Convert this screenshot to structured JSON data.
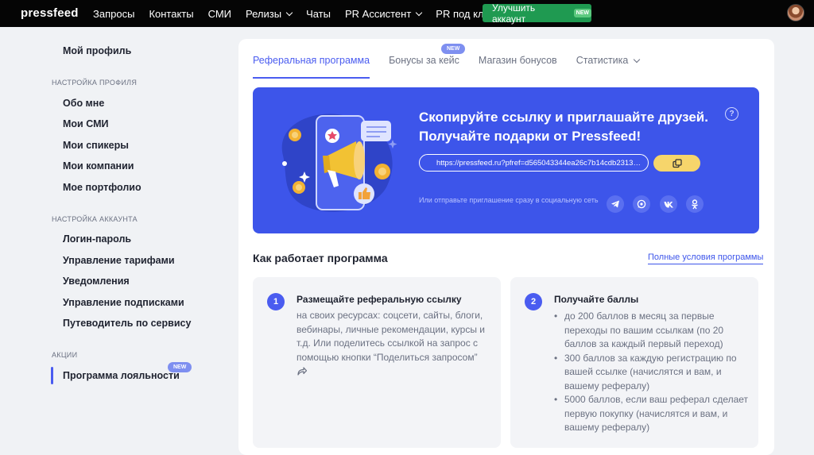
{
  "topbar": {
    "logo": "pressfeed",
    "nav": [
      {
        "label": "Запросы",
        "has_dropdown": false
      },
      {
        "label": "Контакты",
        "has_dropdown": false
      },
      {
        "label": "СМИ",
        "has_dropdown": false
      },
      {
        "label": "Релизы",
        "has_dropdown": true
      },
      {
        "label": "Чаты",
        "has_dropdown": false
      },
      {
        "label": "PR Ассистент",
        "has_dropdown": true
      },
      {
        "label": "PR под ключ",
        "has_dropdown": true
      }
    ],
    "upgrade_label": "Улучшить аккаунт",
    "upgrade_badge": "NEW",
    "upgrade_color": "#1f9a51"
  },
  "sidebar": {
    "profile": "Мой профиль",
    "profile_settings_heading": "Настройка профиля",
    "profile_settings": [
      "Обо мне",
      "Мои СМИ",
      "Мои спикеры",
      "Мои компании",
      "Мое портфолио"
    ],
    "account_settings_heading": "Настройка аккаунта",
    "account_settings": [
      "Логин-пароль",
      "Управление тарифами",
      "Уведомления",
      "Управление подписками",
      "Путеводитель по сервису"
    ],
    "promo_heading": "Акции",
    "active_item": "Программа лояльности",
    "active_badge": "NEW"
  },
  "main": {
    "tabs": [
      {
        "label": "Реферальная программа",
        "active": true
      },
      {
        "label": "Бонусы за кейс",
        "active": false
      },
      {
        "label": "Магазин бонусов",
        "active": false
      },
      {
        "label": "Статистика",
        "active": false,
        "has_dropdown": true
      }
    ],
    "tab_badge": "NEW",
    "banner": {
      "title_line1": "Скопируйте ссылку и приглашайте друзей.",
      "title_line2": "Получайте подарки от Pressfeed!",
      "link": "https://pressfeed.ru?pfref=d565043344ea26c7b14cdb2313…",
      "share_text": "Или отправьте приглашение сразу в социальную сеть",
      "socials": [
        "telegram-icon",
        "whatsapp-icon",
        "vk-icon",
        "odnoklassniki-icon"
      ],
      "help_glyph": "?",
      "background": "#3d55ea"
    },
    "section_title": "Как работает программа",
    "terms_link": "Полные условия программы",
    "steps": [
      {
        "number": "1",
        "title": "Размещайте реферальную ссылку",
        "text": "на своих ресурсах: соцсети, сайты, блоги, вебинары, личные рекомендации, курсы и т.д. Или поделитесь ссылкой на запрос с помощью кнопки “Поделиться запросом”"
      },
      {
        "number": "2",
        "title": "Получайте баллы",
        "bullets": [
          "до 200 баллов в месяц за первые переходы по вашим ссылкам (по 20 баллов за каждый первый переход)",
          "300 баллов за каждую регистрацию по вашей ссылке (начислятся и вам, и вашему рефералу)",
          "5000 баллов, если ваш реферал сделает первую покупку (начислятся и вам, и вашему рефералу)"
        ]
      }
    ]
  }
}
